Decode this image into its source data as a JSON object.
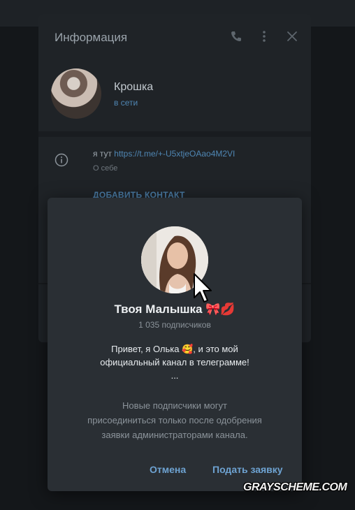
{
  "info_panel": {
    "title": "Информация",
    "profile": {
      "name": "Крошка",
      "status": "в сети"
    },
    "bio": {
      "prefix": "я тут ",
      "link": "https://t.me/+-U5xtjeOAao4M2VI",
      "label": "О себе"
    },
    "add_contact": "ДОБАВИТЬ КОНТАКТ"
  },
  "dialog": {
    "channel_name": "Твоя Малышка 🎀💋",
    "subscribers": "1 035 подписчиков",
    "description": [
      "Привет, я Олька 🥰, и это мой",
      "официальный канал в телеграмме!",
      "..."
    ],
    "notice": [
      "Новые подписчики могут",
      "присоединиться только после одобрения",
      "заявки администраторами канала."
    ],
    "cancel_label": "Отмена",
    "request_label": "Подать заявку"
  },
  "watermark": "GRAYSCHEME.COM",
  "icons": {
    "phone": "phone-icon",
    "more": "more-vertical-icon",
    "close": "close-icon",
    "info": "info-icon",
    "cursor": "mouse-cursor-icon"
  },
  "colors": {
    "accent": "#6ea3d2",
    "link": "#4f86b3",
    "dialog_bg": "#2a2f34",
    "panel_bg": "#1f2327"
  }
}
